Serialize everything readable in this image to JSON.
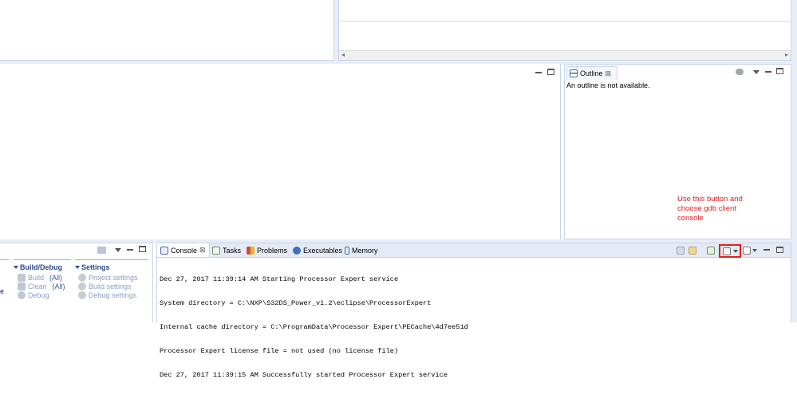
{
  "outline": {
    "tab_label": "Outline",
    "close_glyph": "⊠",
    "message": "An outline is not available."
  },
  "annotation": {
    "lines": [
      "Use this button and",
      "choose gdb client",
      "console"
    ],
    "color": "#e02020"
  },
  "quicklaunch": {
    "build_debug": {
      "header": "Build/Debug",
      "items": [
        {
          "label": "Build",
          "scope": "(All)"
        },
        {
          "label": "Clean",
          "scope": "(All)"
        },
        {
          "label": "Debug",
          "scope": ""
        }
      ]
    },
    "settings": {
      "header": "Settings",
      "items": [
        "Project settings",
        "Build settings",
        "Debug settings"
      ]
    },
    "left_fragment": "e"
  },
  "console": {
    "tabs": [
      {
        "label": "Console",
        "icon": "console-icon",
        "active": true,
        "close": "⊠"
      },
      {
        "label": "Tasks",
        "icon": "tasks-icon"
      },
      {
        "label": "Problems",
        "icon": "problems-icon"
      },
      {
        "label": "Executables",
        "icon": "executables-icon"
      },
      {
        "label": "Memory",
        "icon": "memory-icon"
      }
    ],
    "lines": [
      "Dec 27, 2017 11:39:14 AM Starting Processor Expert service",
      "System directory = C:\\NXP\\S32DS_Power_v1.2\\eclipse\\ProcessorExpert",
      "Internal cache directory = C:\\ProgramData\\Processor Expert\\PECache\\4d7ee51d",
      "Processor Expert license file = not used (no license file)",
      "Dec 27, 2017 11:39:15 AM Successfully started Processor Expert service"
    ]
  },
  "colors": {
    "accent": "#3a5a9c",
    "panel_border": "#c7d3e8",
    "highlight": "#e02020"
  }
}
